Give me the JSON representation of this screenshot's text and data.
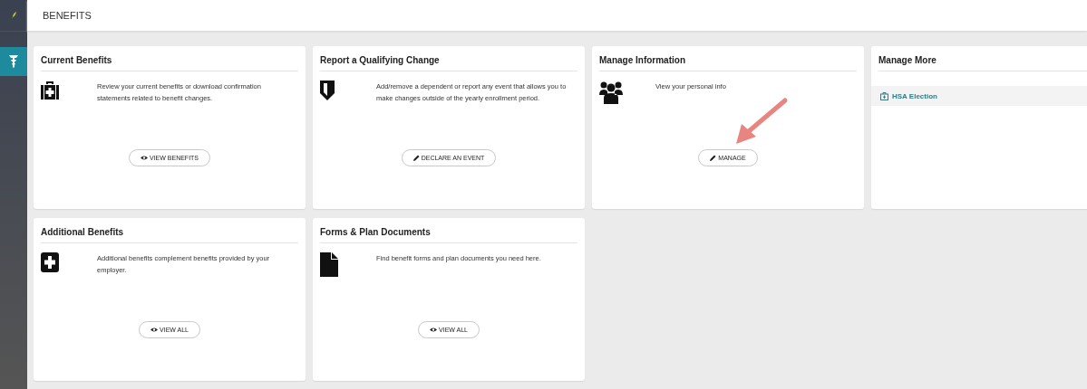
{
  "sidebar": {
    "items": [
      {
        "kind": "caduceus",
        "selected": true
      }
    ]
  },
  "header": {
    "title": "BENEFITS"
  },
  "cards": [
    {
      "kind": "action",
      "title": "Current Benefits",
      "description": "Review your current benefits or download confirmation statements related to benefit changes.",
      "button": {
        "label": "VIEW BENEFITS"
      }
    },
    {
      "kind": "action",
      "title": "Report a Qualifying Change",
      "description": "Add/remove a dependent or report any event that allows you to make changes outside of the yearly enrollment period.",
      "button": {
        "label": "DECLARE AN EVENT"
      }
    },
    {
      "kind": "action",
      "title": "Manage Information",
      "description": "View your personal info",
      "button": {
        "label": "MANAGE"
      }
    },
    {
      "kind": "links",
      "title": "Manage More",
      "links": [
        {
          "label": "HSA Election"
        }
      ]
    },
    {
      "kind": "action",
      "title": "Additional Benefits",
      "description": "Additional benefits complement benefits provided by your employer.",
      "button": {
        "label": "VIEW ALL"
      }
    },
    {
      "kind": "action",
      "title": "Forms & Plan Documents",
      "description": "Find benefit forms and plan documents you need here.",
      "button": {
        "label": "VIEW ALL"
      }
    }
  ]
}
